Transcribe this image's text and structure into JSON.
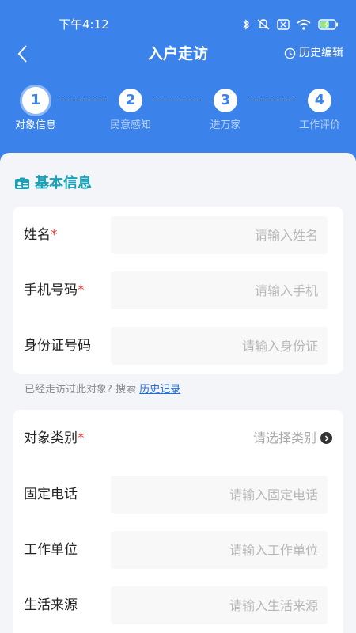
{
  "status_bar": {
    "time": "下午4:12"
  },
  "nav": {
    "title": "入户走访",
    "history_edit": "历史编辑"
  },
  "steps": [
    {
      "number": "1",
      "label": "对象信息"
    },
    {
      "number": "2",
      "label": "民意感知"
    },
    {
      "number": "3",
      "label": "进万家"
    },
    {
      "number": "4",
      "label": "工作评价"
    }
  ],
  "basic_info": {
    "title": "基本信息",
    "name": {
      "label": "姓名",
      "placeholder": "请输入姓名"
    },
    "phone": {
      "label": "手机号码",
      "placeholder": "请输入手机"
    },
    "id_number": {
      "label": "身份证号码",
      "placeholder": "请输入身份证"
    },
    "required_mark": "*"
  },
  "hint": {
    "text": "已经走访过此对象? 搜索",
    "link": "历史记录"
  },
  "details": {
    "category": {
      "label": "对象类别",
      "value": "请选择类别"
    },
    "landline": {
      "label": "固定电话",
      "placeholder": "请输入固定电话"
    },
    "work_unit": {
      "label": "工作单位",
      "placeholder": "请输入工作单位"
    },
    "income_source": {
      "label": "生活来源",
      "placeholder": "请输入生活来源"
    }
  },
  "colors": {
    "primary": "#3b83ea",
    "section_title": "#17a2b8",
    "required": "#e53935",
    "link": "#1f6ce0"
  },
  "icons": {
    "back": "chevron-left-icon",
    "history": "clock-icon",
    "section": "id-card-icon",
    "select": "chevron-right-circle-icon"
  }
}
